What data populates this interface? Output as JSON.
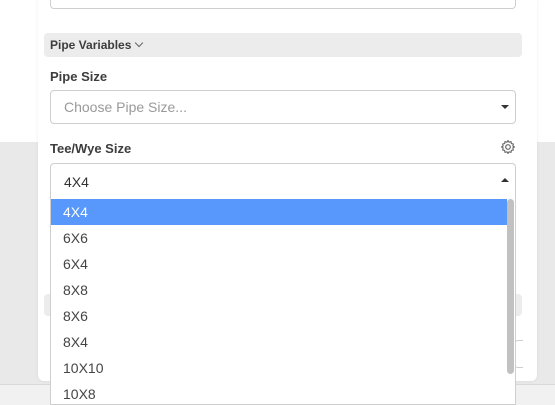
{
  "section": {
    "title": "Pipe Variables"
  },
  "pipe_size": {
    "label": "Pipe Size",
    "placeholder": "Choose Pipe Size..."
  },
  "tee_wye_size": {
    "label": "Tee/Wye Size",
    "value": "4X4",
    "options": [
      "4X4",
      "6X6",
      "6X4",
      "8X8",
      "8X6",
      "8X4",
      "10X10",
      "10X8"
    ],
    "selected_index": 0
  },
  "icons": {
    "gear": "gear-icon",
    "section_toggle": "chevron-down-icon"
  },
  "colors": {
    "highlight": "#5897fb"
  }
}
